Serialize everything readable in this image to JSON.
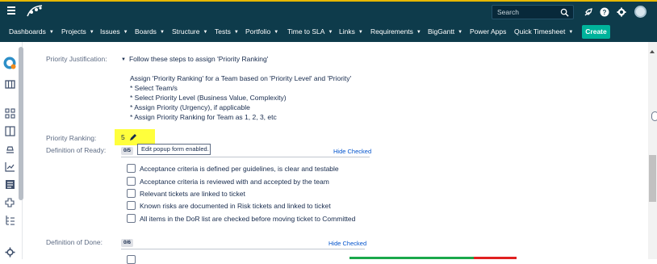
{
  "colors": {
    "header_bg": "#0e3b4b",
    "accent": "#00b39b",
    "highlight": "#ffff3c",
    "link": "#0052cc"
  },
  "topbar": {
    "search_placeholder": "Search",
    "icons": [
      "hamburger-icon",
      "app-logo",
      "search-icon",
      "rocket-icon",
      "help-icon",
      "settings-icon",
      "user-avatar"
    ]
  },
  "nav": {
    "items": [
      {
        "label": "Dashboards",
        "dropdown": true
      },
      {
        "label": "Projects",
        "dropdown": true
      },
      {
        "label": "Issues",
        "dropdown": true
      },
      {
        "label": "Boards",
        "dropdown": true
      },
      {
        "label": "Structure",
        "dropdown": true
      },
      {
        "label": "Tests",
        "dropdown": true
      },
      {
        "label": "Portfolio",
        "dropdown": true
      },
      {
        "label": "Time to SLA",
        "dropdown": true
      },
      {
        "label": "Links",
        "dropdown": true
      },
      {
        "label": "Requirements",
        "dropdown": true
      },
      {
        "label": "BigGantt",
        "dropdown": true
      },
      {
        "label": "Power Apps",
        "dropdown": false
      },
      {
        "label": "Quick Timesheet",
        "dropdown": true
      }
    ],
    "create_label": "Create",
    "chevron": "▼"
  },
  "fields": {
    "priority_justification": {
      "label": "Priority Justification:",
      "toggle": "Follow these steps to assign 'Priority Ranking'",
      "intro": "Assign 'Priority Ranking' for a Team based on 'Priority Level' and 'Priority'",
      "steps": [
        "* Select Team/s",
        "* Select Priority Level (Business Value, Complexity)",
        "* Assign Priority (Urgency), if applicable",
        "* Assign Priority Ranking for Team as 1, 2, 3, etc"
      ]
    },
    "priority_ranking": {
      "label": "Priority Ranking:",
      "value": "5",
      "tooltip": "Edit popup form enabled."
    },
    "definition_of_ready": {
      "label": "Definition of Ready:",
      "count": "0/5",
      "hide_label": "Hide Checked",
      "items": [
        {
          "label": "Acceptance criteria is defined per guidelines, is clear and testable",
          "checked": false
        },
        {
          "label": "Acceptance criteria is reviewed with and accepted by the team",
          "checked": false
        },
        {
          "label": "Relevant tickets are linked to ticket",
          "checked": false
        },
        {
          "label": "Known risks are documented in Risk tickets and linked to ticket",
          "checked": false
        },
        {
          "label": "All items in the DoR list are checked before moving ticket to Committed",
          "checked": false
        }
      ]
    },
    "definition_of_done": {
      "label": "Definition of Done:",
      "count": "0/6",
      "hide_label": "Hide Checked"
    }
  }
}
